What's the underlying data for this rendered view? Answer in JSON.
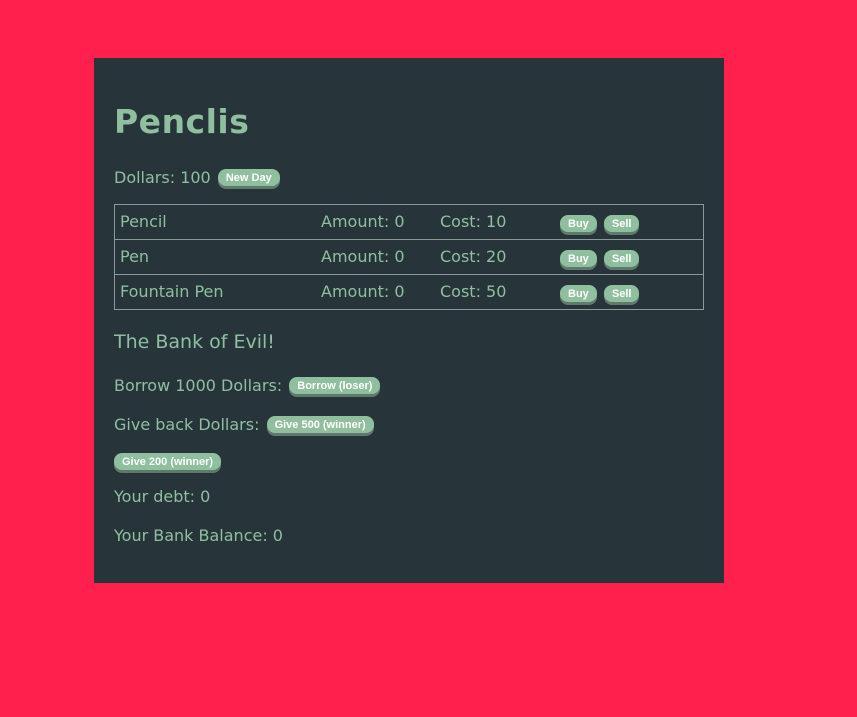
{
  "app": {
    "title": "Penclis"
  },
  "wallet": {
    "dollars_label": "Dollars: 100",
    "new_day_label": "New Day"
  },
  "items": [
    {
      "name": "Pencil",
      "amount": "Amount: 0",
      "cost": "Cost: 10",
      "buy": "Buy",
      "sell": "Sell"
    },
    {
      "name": "Pen",
      "amount": "Amount: 0",
      "cost": "Cost: 20",
      "buy": "Buy",
      "sell": "Sell"
    },
    {
      "name": "Fountain Pen",
      "amount": "Amount: 0",
      "cost": "Cost: 50",
      "buy": "Buy",
      "sell": "Sell"
    }
  ],
  "bank": {
    "title": "The Bank of Evil!",
    "borrow_text": "Borrow 1000 Dollars:",
    "borrow_button": "Borrow (loser)",
    "giveback_text": "Give back Dollars:",
    "give500_button": "Give 500 (winner)",
    "give200_button": "Give 200 (winner)",
    "debt_text": "Your debt: 0",
    "balance_text": "Your Bank Balance: 0"
  },
  "colors": {
    "background": "#ff204e",
    "panel": "#27353b",
    "accent": "#8fbf9f",
    "button_text": "#ffffff"
  }
}
